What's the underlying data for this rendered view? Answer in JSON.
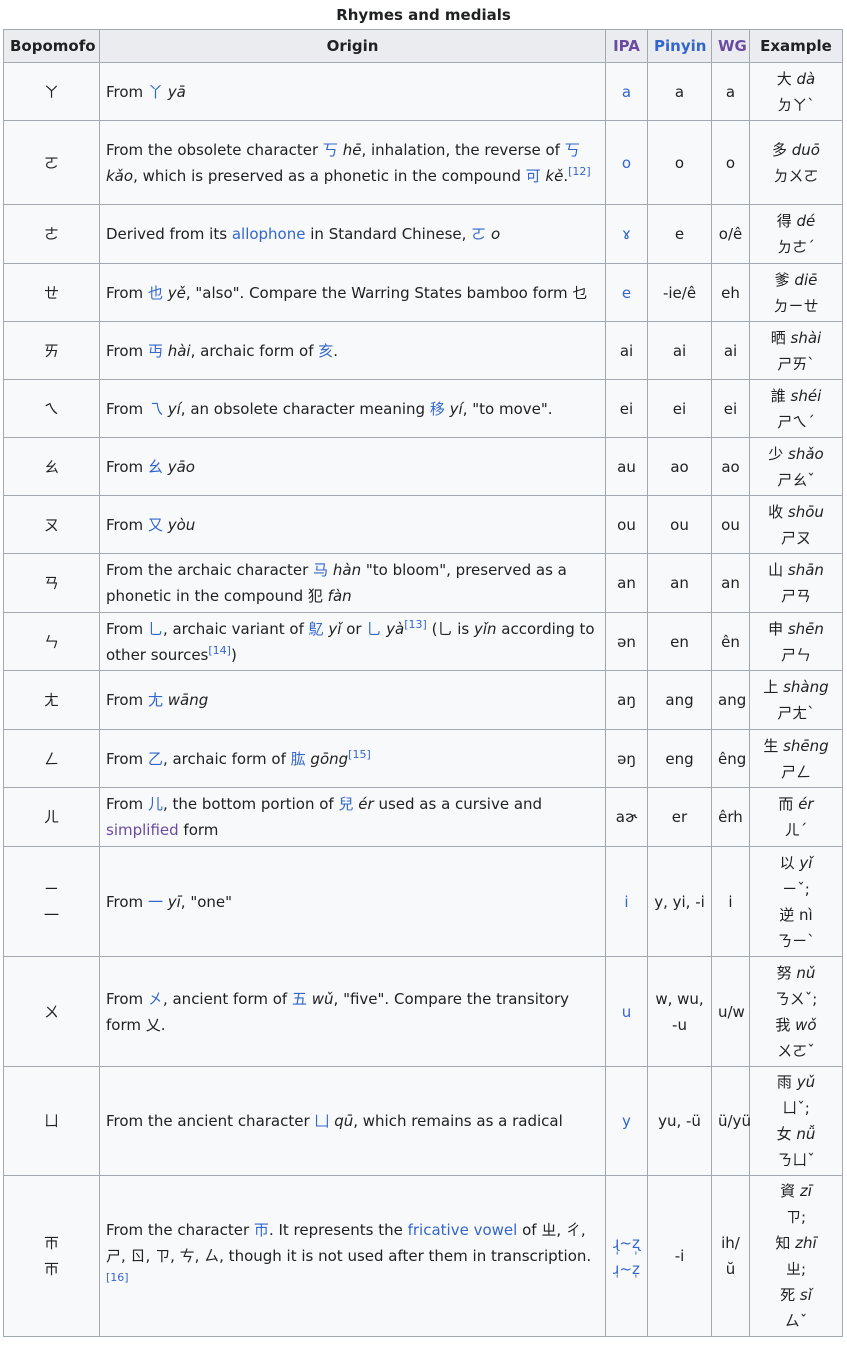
{
  "caption": "Rhymes and medials",
  "headers": {
    "bopomofo": "Bopomofo",
    "origin": "Origin",
    "ipa": "IPA",
    "pinyin": "Pinyin",
    "wg": "WG",
    "example": "Example"
  },
  "rows": [
    {
      "bopomofo": "ㄚ",
      "origin": [
        {
          "t": "From "
        },
        {
          "t": "丫",
          "link": true
        },
        {
          "t": " "
        },
        {
          "t": "yā",
          "i": true
        }
      ],
      "ipa": "a",
      "ipa_link": true,
      "pinyin": "a",
      "wg": "a",
      "example": [
        [
          {
            "t": "大 "
          },
          {
            "t": "dà",
            "i": true
          }
        ],
        [
          {
            "t": "ㄉㄚˋ"
          }
        ]
      ]
    },
    {
      "bopomofo": "ㄛ",
      "origin": [
        {
          "t": "From the obsolete character "
        },
        {
          "t": "丂",
          "link": true
        },
        {
          "t": " "
        },
        {
          "t": "hē",
          "i": true
        },
        {
          "t": ", inhalation, the reverse of "
        },
        {
          "t": "丂",
          "link": true
        },
        {
          "t": " "
        },
        {
          "t": "kǎo",
          "i": true
        },
        {
          "t": ", which is preserved as a phonetic in the compound "
        },
        {
          "t": "可",
          "link": true
        },
        {
          "t": " "
        },
        {
          "t": "kě",
          "i": true
        },
        {
          "t": "."
        },
        {
          "t": "[12]",
          "sup": true
        }
      ],
      "ipa": "o",
      "ipa_link": true,
      "pinyin": "o",
      "wg": "o",
      "example": [
        [
          {
            "t": "多 "
          },
          {
            "t": "duō",
            "i": true
          }
        ],
        [
          {
            "t": "ㄉㄨㄛ"
          }
        ]
      ]
    },
    {
      "bopomofo": "ㄜ",
      "origin": [
        {
          "t": "Derived from its "
        },
        {
          "t": "allophone",
          "link": true
        },
        {
          "t": " in Standard Chinese, "
        },
        {
          "t": "ㄛ",
          "link": true
        },
        {
          "t": " "
        },
        {
          "t": "o",
          "i": true
        }
      ],
      "ipa": "ɤ",
      "ipa_link": true,
      "pinyin": "e",
      "wg": "o/ê",
      "example": [
        [
          {
            "t": "得 "
          },
          {
            "t": "dé",
            "i": true
          }
        ],
        [
          {
            "t": "ㄉㄜˊ"
          }
        ]
      ]
    },
    {
      "bopomofo": "ㄝ",
      "origin": [
        {
          "t": "From "
        },
        {
          "t": "也",
          "link": true
        },
        {
          "t": " "
        },
        {
          "t": "yě",
          "i": true
        },
        {
          "t": ", \"also\". Compare the Warring States bamboo form "
        },
        {
          "t": "乜"
        }
      ],
      "ipa": "e",
      "ipa_link": true,
      "pinyin": "-ie/ê",
      "wg": "eh",
      "example": [
        [
          {
            "t": "爹 "
          },
          {
            "t": "diē",
            "i": true
          }
        ],
        [
          {
            "t": "ㄉㄧㄝ"
          }
        ]
      ]
    },
    {
      "bopomofo": "ㄞ",
      "origin": [
        {
          "t": "From "
        },
        {
          "t": "丏",
          "link": true
        },
        {
          "t": " "
        },
        {
          "t": "hài",
          "i": true
        },
        {
          "t": ", archaic form of "
        },
        {
          "t": "亥",
          "link": true
        },
        {
          "t": "."
        }
      ],
      "ipa": "ai",
      "ipa_link": false,
      "pinyin": "ai",
      "wg": "ai",
      "example": [
        [
          {
            "t": "晒 "
          },
          {
            "t": "shài",
            "i": true
          }
        ],
        [
          {
            "t": "ㄕㄞˋ"
          }
        ]
      ]
    },
    {
      "bopomofo": "ㄟ",
      "origin": [
        {
          "t": "From "
        },
        {
          "t": "乁",
          "link": true
        },
        {
          "t": " "
        },
        {
          "t": "yí",
          "i": true
        },
        {
          "t": ", an obsolete character meaning "
        },
        {
          "t": "移",
          "link": true
        },
        {
          "t": " "
        },
        {
          "t": "yí",
          "i": true
        },
        {
          "t": ", \"to move\"."
        }
      ],
      "ipa": "ei",
      "ipa_link": false,
      "pinyin": "ei",
      "wg": "ei",
      "example": [
        [
          {
            "t": "誰 "
          },
          {
            "t": "shéi",
            "i": true
          }
        ],
        [
          {
            "t": "ㄕㄟˊ"
          }
        ]
      ]
    },
    {
      "bopomofo": "ㄠ",
      "origin": [
        {
          "t": "From "
        },
        {
          "t": "幺",
          "link": true
        },
        {
          "t": " "
        },
        {
          "t": "yāo",
          "i": true
        }
      ],
      "ipa": "au",
      "ipa_link": false,
      "pinyin": "ao",
      "wg": "ao",
      "example": [
        [
          {
            "t": "少 "
          },
          {
            "t": "shǎo",
            "i": true
          }
        ],
        [
          {
            "t": "ㄕㄠˇ"
          }
        ]
      ]
    },
    {
      "bopomofo": "ㄡ",
      "origin": [
        {
          "t": "From "
        },
        {
          "t": "又",
          "link": true
        },
        {
          "t": " "
        },
        {
          "t": "yòu",
          "i": true
        }
      ],
      "ipa": "ou",
      "ipa_link": false,
      "pinyin": "ou",
      "wg": "ou",
      "example": [
        [
          {
            "t": "收 "
          },
          {
            "t": "shōu",
            "i": true
          }
        ],
        [
          {
            "t": "ㄕㄡ"
          }
        ]
      ]
    },
    {
      "bopomofo": "ㄢ",
      "origin": [
        {
          "t": "From the archaic character "
        },
        {
          "t": "马",
          "link": true
        },
        {
          "t": " "
        },
        {
          "t": "hàn",
          "i": true
        },
        {
          "t": " \"to bloom\", preserved as a phonetic in the compound "
        },
        {
          "t": "犯"
        },
        {
          "t": " "
        },
        {
          "t": "fàn",
          "i": true
        }
      ],
      "ipa": "an",
      "ipa_link": false,
      "pinyin": "an",
      "wg": "an",
      "example": [
        [
          {
            "t": "山 "
          },
          {
            "t": "shān",
            "i": true
          }
        ],
        [
          {
            "t": "ㄕㄢ"
          }
        ]
      ]
    },
    {
      "bopomofo": "ㄣ",
      "origin": [
        {
          "t": "From "
        },
        {
          "t": "乚",
          "link": true
        },
        {
          "t": ", archaic variant of "
        },
        {
          "t": "鳦",
          "link": true
        },
        {
          "t": " "
        },
        {
          "t": "yǐ",
          "i": true
        },
        {
          "t": " or "
        },
        {
          "t": "乚",
          "link": true
        },
        {
          "t": " "
        },
        {
          "t": "yà",
          "i": true
        },
        {
          "t": "[13]",
          "sup": true
        },
        {
          "t": " (乚 is  "
        },
        {
          "t": "yǐn",
          "i": true
        },
        {
          "t": " according to other sources"
        },
        {
          "t": "[14]",
          "sup": true
        },
        {
          "t": ")"
        }
      ],
      "ipa": "ən",
      "ipa_link": false,
      "pinyin": "en",
      "wg": "ên",
      "example": [
        [
          {
            "t": "申 "
          },
          {
            "t": "shēn",
            "i": true
          }
        ],
        [
          {
            "t": "ㄕㄣ"
          }
        ]
      ]
    },
    {
      "bopomofo": "ㄤ",
      "origin": [
        {
          "t": "From "
        },
        {
          "t": "尢",
          "link": true
        },
        {
          "t": " "
        },
        {
          "t": "wāng",
          "i": true
        }
      ],
      "ipa": "aŋ",
      "ipa_link": false,
      "pinyin": "ang",
      "wg": "ang",
      "example": [
        [
          {
            "t": "上 "
          },
          {
            "t": "shàng",
            "i": true
          }
        ],
        [
          {
            "t": "ㄕㄤˋ"
          }
        ]
      ]
    },
    {
      "bopomofo": "ㄥ",
      "origin": [
        {
          "t": "From "
        },
        {
          "t": "乙",
          "link": true
        },
        {
          "t": ", archaic form of "
        },
        {
          "t": "肱",
          "link": true
        },
        {
          "t": " "
        },
        {
          "t": "gōng",
          "i": true
        },
        {
          "t": "[15]",
          "sup": true
        }
      ],
      "ipa": "əŋ",
      "ipa_link": false,
      "pinyin": "eng",
      "wg": "êng",
      "example": [
        [
          {
            "t": "生 "
          },
          {
            "t": "shēng",
            "i": true
          }
        ],
        [
          {
            "t": "ㄕㄥ"
          }
        ]
      ]
    },
    {
      "bopomofo": "ㄦ",
      "origin": [
        {
          "t": "From "
        },
        {
          "t": "儿",
          "link": true
        },
        {
          "t": ", the bottom portion of "
        },
        {
          "t": "兒",
          "link": true
        },
        {
          "t": " "
        },
        {
          "t": "ér",
          "i": true
        },
        {
          "t": " used as a cursive and "
        },
        {
          "t": "simplified",
          "visited": true
        },
        {
          "t": " form"
        }
      ],
      "ipa": "aɚ",
      "ipa_link": false,
      "pinyin": "er",
      "wg": "êrh",
      "example": [
        [
          {
            "t": "而 "
          },
          {
            "t": "ér",
            "i": true
          }
        ],
        [
          {
            "t": "ㄦˊ"
          }
        ]
      ]
    },
    {
      "bopomofo": "ㄧ\n一",
      "origin": [
        {
          "t": "From "
        },
        {
          "t": "一",
          "link": true
        },
        {
          "t": " "
        },
        {
          "t": "yī",
          "i": true
        },
        {
          "t": ", \"one\""
        }
      ],
      "ipa": "i",
      "ipa_link": true,
      "pinyin": "y, yi, -i",
      "wg": "i",
      "example": [
        [
          {
            "t": "以 "
          },
          {
            "t": "yǐ",
            "i": true
          }
        ],
        [
          {
            "t": "ㄧˇ;"
          }
        ],
        [
          {
            "t": "逆 "
          },
          {
            "t": "nì"
          }
        ],
        [
          {
            "t": "ㄋㄧˋ"
          }
        ]
      ]
    },
    {
      "bopomofo": "ㄨ",
      "origin": [
        {
          "t": "From "
        },
        {
          "t": "㐅",
          "link": true
        },
        {
          "t": ", ancient form of "
        },
        {
          "t": "五",
          "link": true
        },
        {
          "t": " "
        },
        {
          "t": "wǔ",
          "i": true
        },
        {
          "t": ", \"five\". Compare the transitory form "
        },
        {
          "t": "乂"
        },
        {
          "t": "."
        }
      ],
      "ipa": "u",
      "ipa_link": true,
      "pinyin": "w, wu,\n-u",
      "wg": "u/w",
      "example": [
        [
          {
            "t": "努 "
          },
          {
            "t": "nǔ",
            "i": true
          }
        ],
        [
          {
            "t": "ㄋㄨˇ;"
          }
        ],
        [
          {
            "t": "我 "
          },
          {
            "t": "wǒ",
            "i": true
          }
        ],
        [
          {
            "t": "ㄨㄛˇ"
          }
        ]
      ]
    },
    {
      "bopomofo": "ㄩ",
      "origin": [
        {
          "t": "From the ancient character "
        },
        {
          "t": "凵",
          "link": true
        },
        {
          "t": " "
        },
        {
          "t": "qū",
          "i": true
        },
        {
          "t": ", which remains as a radical"
        }
      ],
      "ipa": "y",
      "ipa_link": true,
      "pinyin": "yu, -ü",
      "wg": "ü/yü",
      "example": [
        [
          {
            "t": "雨 "
          },
          {
            "t": "yǔ",
            "i": true
          }
        ],
        [
          {
            "t": "ㄩˇ;"
          }
        ],
        [
          {
            "t": "女 "
          },
          {
            "t": "nǚ",
            "i": true
          }
        ],
        [
          {
            "t": "ㄋㄩˇ"
          }
        ]
      ]
    },
    {
      "bopomofo": "ㄭ\nㄭ",
      "origin": [
        {
          "t": "From the character "
        },
        {
          "t": "帀",
          "link": true
        },
        {
          "t": ". It represents the "
        },
        {
          "t": "fricative vowel",
          "link": true
        },
        {
          "t": " of "
        },
        {
          "t": "ㄓ"
        },
        {
          "t": ", ㄔ, ㄕ, ㄖ, ㄗ, ㄘ, ㄙ, though it is not used after them in transcription."
        },
        {
          "t": "[16]",
          "sup": true
        }
      ],
      "ipa": "ɻ̩~ʐ̩\nɹ̩~z̩",
      "ipa_link": true,
      "pinyin": "-i",
      "wg": "ih/ŭ",
      "example": [
        [
          {
            "t": "資 "
          },
          {
            "t": "zī",
            "i": true
          }
        ],
        [
          {
            "t": "ㄗ;"
          }
        ],
        [
          {
            "t": "知 "
          },
          {
            "t": "zhī",
            "i": true
          }
        ],
        [
          {
            "t": "ㄓ;"
          }
        ],
        [
          {
            "t": "死 "
          },
          {
            "t": "sǐ",
            "i": true
          }
        ],
        [
          {
            "t": "ㄙˇ"
          }
        ]
      ]
    }
  ],
  "row_heights": [
    58,
    84,
    59,
    58,
    58,
    58,
    58,
    58,
    59,
    58,
    59,
    58,
    59,
    110,
    110,
    109,
    161
  ],
  "colors": {
    "link": "#3366cc",
    "visited": "#6b4ba1",
    "header_bg": "#eaecf0",
    "cell_bg": "#f8f9fa",
    "border": "#a2a9b1"
  }
}
